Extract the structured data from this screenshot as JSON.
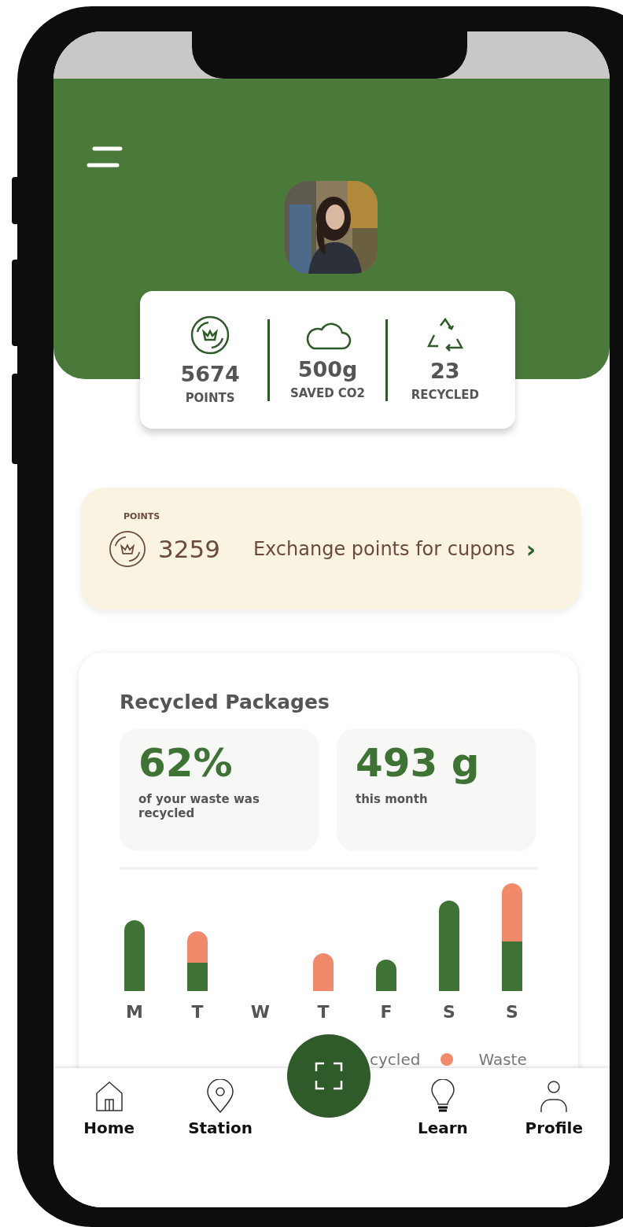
{
  "stats": [
    {
      "kind": "points",
      "value": "5674",
      "label": "POINTS"
    },
    {
      "kind": "cloud",
      "value": "500g",
      "label": "SAVED CO2"
    },
    {
      "kind": "recycle",
      "value": "23",
      "label": "RECYCLED"
    }
  ],
  "points_card": {
    "label": "POINTS",
    "value": "3259",
    "link": "Exchange points for cupons",
    "chevron": "›"
  },
  "recycled_packages": {
    "title": "Recycled Packages",
    "tiles": [
      {
        "value": "62%",
        "caption": "of your waste was recycled"
      },
      {
        "value": "493 g",
        "caption": "this month"
      }
    ],
    "days": [
      "M",
      "T",
      "W",
      "T",
      "F",
      "S",
      "S"
    ],
    "legend": [
      {
        "label": "cycled"
      },
      {
        "label": "Waste",
        "color": "#f08a6a"
      }
    ]
  },
  "nav": [
    {
      "kind": "home",
      "label": "Home"
    },
    {
      "kind": "station",
      "label": "Station"
    },
    {
      "kind": "scan"
    },
    {
      "kind": "learn",
      "label": "Learn"
    },
    {
      "kind": "profile",
      "label": "Profile"
    }
  ]
}
